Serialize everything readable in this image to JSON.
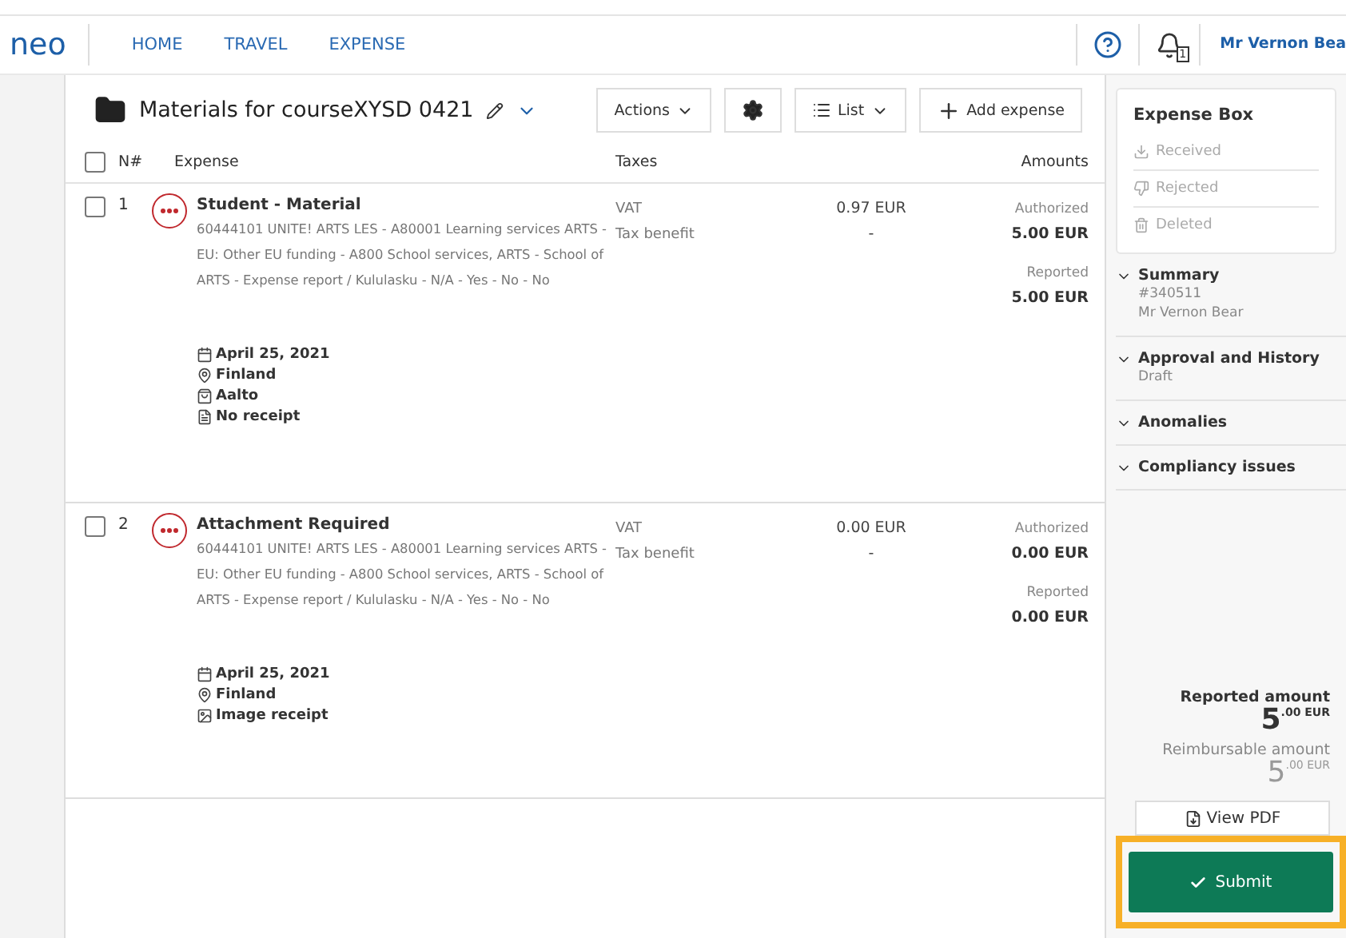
{
  "nav": {
    "logo": "neo",
    "links": [
      {
        "label": "HOME"
      },
      {
        "label": "TRAVEL"
      },
      {
        "label": "EXPENSE"
      }
    ],
    "notification_count": "1",
    "user": "Mr Vernon Bea"
  },
  "toolbar": {
    "title": "Materials for courseXYSD 0421",
    "actions": "Actions",
    "view": "List",
    "add": "Add expense"
  },
  "table": {
    "all_checked": false,
    "columns": [
      "N#",
      "Expense",
      "Taxes",
      "Amounts"
    ],
    "rows": [
      {
        "number": "1",
        "checked": false,
        "title": "Student - Material",
        "description": "60444101 UNITE! ARTS LES - A80001 Learning services ARTS - EU: Other EU funding - A800 School services, ARTS - School of ARTS - Expense report / Kululasku - N/A - Yes - No - No",
        "tax_type": "VAT",
        "tax_note": "Tax benefit",
        "tax_amount": "0.97 EUR",
        "tax_dash": "-",
        "authorized_label": "Authorized",
        "authorized": "5.00 EUR",
        "reported_label": "Reported",
        "reported": "5.00 EUR",
        "details": [
          {
            "kind": "date",
            "text": "April 25, 2021"
          },
          {
            "kind": "place",
            "text": "Finland"
          },
          {
            "kind": "merchant",
            "text": "Aalto"
          },
          {
            "kind": "no-receipt",
            "text": "No receipt"
          }
        ]
      },
      {
        "number": "2",
        "checked": false,
        "title": "Attachment Required",
        "description": "60444101 UNITE! ARTS LES - A80001 Learning services ARTS - EU: Other EU funding - A800 School services, ARTS - School of ARTS - Expense report / Kululasku - N/A - Yes - No - No",
        "tax_type": "VAT",
        "tax_note": "Tax benefit",
        "tax_amount": "0.00 EUR",
        "tax_dash": "-",
        "authorized_label": "Authorized",
        "authorized": "0.00 EUR",
        "reported_label": "Reported",
        "reported": "0.00 EUR",
        "details": [
          {
            "kind": "date",
            "text": "April 25, 2021"
          },
          {
            "kind": "place",
            "text": "Finland"
          },
          {
            "kind": "image-receipt",
            "text": "Image receipt"
          }
        ]
      }
    ]
  },
  "sidebar": {
    "expense_box": {
      "title": "Expense Box",
      "items": [
        {
          "kind": "received",
          "label": "Received"
        },
        {
          "kind": "rejected",
          "label": "Rejected"
        },
        {
          "kind": "deleted",
          "label": "Deleted"
        }
      ]
    },
    "sections": [
      {
        "title": "Summary",
        "lines": [
          "#340511",
          "Mr Vernon Bear"
        ]
      },
      {
        "title": "Approval and History",
        "lines": [
          "Draft"
        ]
      },
      {
        "title": "Anomalies"
      },
      {
        "title": "Compliancy issues"
      }
    ],
    "reported_label": "Reported amount",
    "reported_whole": "5",
    "reported_fraction": ".00 EUR",
    "reimbursable_label": "Reimbursable amount",
    "reimbursable_whole": "5",
    "reimbursable_fraction": ".00 EUR",
    "view_pdf": "View PDF",
    "submit": "Submit",
    "submit_highlighted": true
  }
}
